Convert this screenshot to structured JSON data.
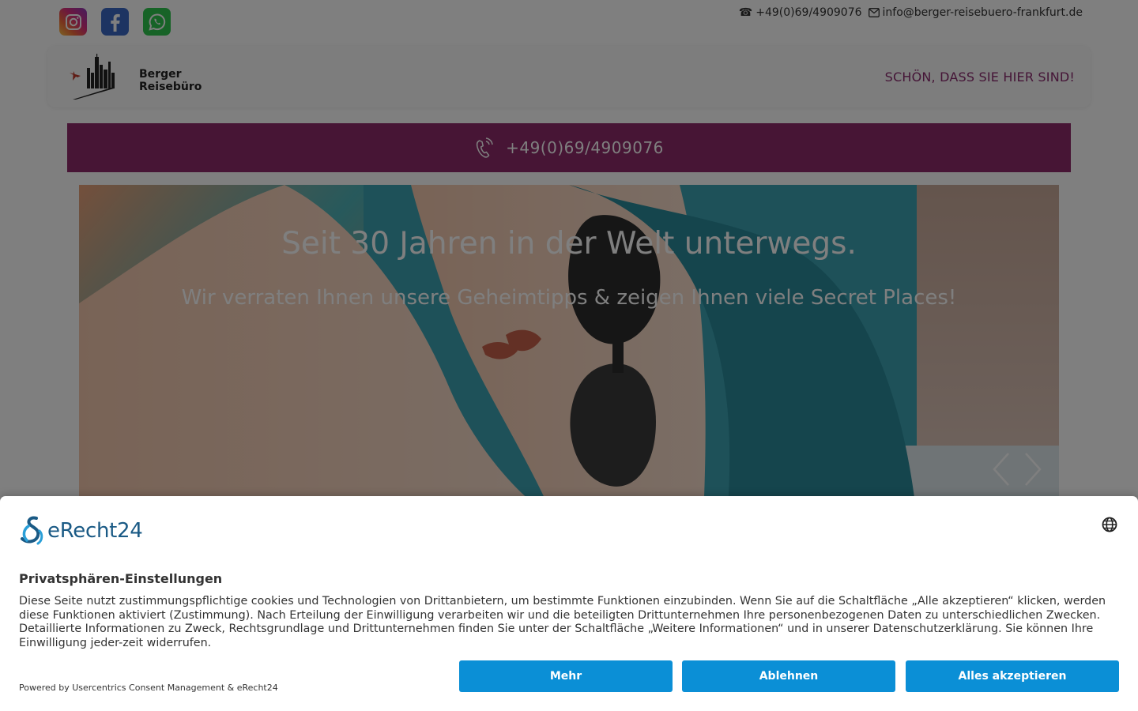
{
  "header": {
    "social": [
      {
        "icon": "instagram-icon"
      },
      {
        "icon": "facebook-icon"
      },
      {
        "icon": "whatsapp-icon"
      }
    ],
    "phone": "+49(0)69/4909076",
    "email": "info@berger-reisebuero-frankfurt.de"
  },
  "navbar": {
    "logo_line1": "Berger",
    "logo_line2": "Reisebüro",
    "tagline": "SCHÖN, DASS SIE HIER SIND!"
  },
  "phonebar": {
    "number": "+49(0)69/4909076"
  },
  "hero": {
    "title": "Seit 30 Jahren in der Welt unterwegs.",
    "subtitle": "Wir verraten Ihnen unsere Geheimtipps & zeigen Ihnen viele Secret Places!"
  },
  "consent": {
    "brand": "eRecht24",
    "title": "Privatsphären-Einstellungen",
    "text": "Diese Seite nutzt zustimmungspflichtige cookies und Technologien von Drittanbietern, um bestimmte Funktionen einzubinden. Wenn Sie auf die Schaltfläche „Alle akzeptieren“ klicken, werden diese Funktionen aktiviert (Zustimmung). Nach Erteilung der Einwilligung verarbeiten wir und die beteiligten Drittunternehmen Ihre personenbezogenen Daten zu unterschiedlichen Zwecken. Detaillierte Informationen zu Zweck, Rechtsgrundlage und Drittunternehmen finden Sie unter der Schaltfläche „Weitere Informationen“ und in unserer Datenschutzerklärung. Sie können Ihre Einwilligung jeder-zeit widerrufen.",
    "powered": "Powered by Usercentrics Consent Management & eRecht24",
    "buttons": {
      "more": "Mehr",
      "deny": "Ablehnen",
      "accept": "Alles akzeptieren"
    }
  },
  "colors": {
    "brand_purple": "#8e2b6b",
    "button_blue": "#0b8fd6",
    "erecht_blue": "#1a5a85"
  }
}
